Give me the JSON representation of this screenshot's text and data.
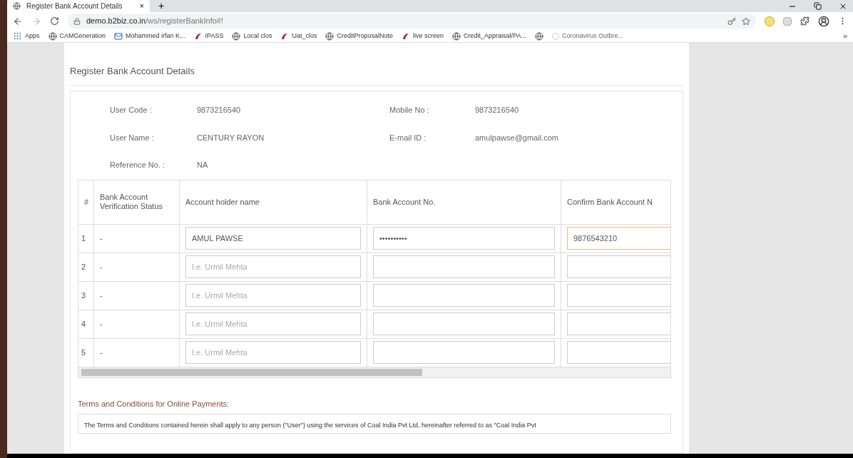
{
  "browser": {
    "tab_title": "Register Bank Account Details",
    "tab_close": "×",
    "new_tab": "+",
    "url_host": "demo.b2biz.co.in",
    "url_path": "/ws/registerBankInfo#!",
    "bookmarks": [
      {
        "label": "Apps",
        "kind": "apps"
      },
      {
        "label": "CAMGeneration",
        "kind": "globe"
      },
      {
        "label": "Mohammed irfan K...",
        "kind": "mail"
      },
      {
        "label": "IPASS",
        "kind": "swirl"
      },
      {
        "label": "Local clos",
        "kind": "globe"
      },
      {
        "label": "Uat_clos",
        "kind": "swirl"
      },
      {
        "label": "CreditProposalNote",
        "kind": "globe"
      },
      {
        "label": "live screen",
        "kind": "swirl"
      },
      {
        "label": "Credit_Appraisal/PA...",
        "kind": "globe"
      },
      {
        "kind": "globe"
      },
      {
        "label": "Coronavirus Outbre...",
        "kind": "faint"
      }
    ],
    "more": "»"
  },
  "page": {
    "title": "Register Bank Account Details",
    "info": [
      {
        "label": "User Code :",
        "value": "9873216540"
      },
      {
        "label": "Mobile No :",
        "value": "9873216540"
      },
      {
        "label": "User Name :",
        "value": "CENTURY RAYON"
      },
      {
        "label": "E-mail ID :",
        "value": "amulpawse@gmail.com"
      },
      {
        "label": "Reference No. :",
        "value": "NA"
      }
    ],
    "table": {
      "columns": [
        "#",
        "Bank Account Verification Status",
        "Account holder name",
        "Bank Account No.",
        "Confirm Bank Account N"
      ],
      "rows": [
        {
          "index": "1",
          "status": "-",
          "holder": "AMUL PAWSE",
          "account": "••••••••••",
          "confirm": "9876543210",
          "focused": true
        },
        {
          "index": "2",
          "status": "-",
          "holder_placeholder": "I.e. Urmil Mehta",
          "focused": false
        },
        {
          "index": "3",
          "status": "-",
          "holder_placeholder": "I.e. Urmil Mehta",
          "focused": false
        },
        {
          "index": "4",
          "status": "-",
          "holder_placeholder": "I.e. Urmil Mehta",
          "focused": false
        },
        {
          "index": "5",
          "status": "-",
          "holder_placeholder": "I.e. Urmil Mehta",
          "focused": false
        }
      ]
    },
    "terms_heading": "Terms and Conditions for Online Payments:",
    "terms_text": "The Terms and Conditions contained herein shall apply to any person (\"User\") using the services of Coal India Pvt Ltd, hereinafter referred to as \"Coal India Pvt"
  }
}
